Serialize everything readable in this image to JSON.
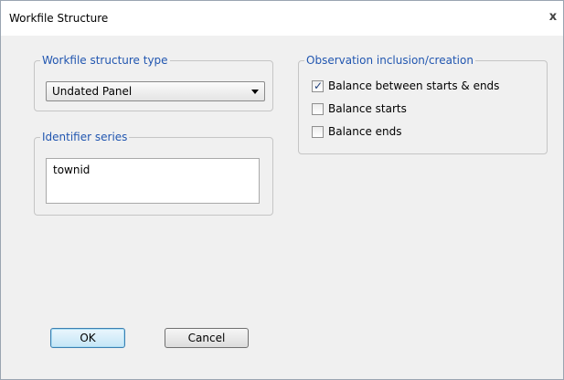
{
  "dialog": {
    "title": "Workfile Structure",
    "close_glyph": "x"
  },
  "structure_type": {
    "legend": "Workfile structure type",
    "selected": "Undated Panel"
  },
  "identifier_series": {
    "legend": "Identifier series",
    "items": [
      "townid"
    ]
  },
  "observation": {
    "legend": "Observation inclusion/creation",
    "options": [
      {
        "label": "Balance between starts & ends",
        "checked": true
      },
      {
        "label": "Balance starts",
        "checked": false
      },
      {
        "label": "Balance ends",
        "checked": false
      }
    ]
  },
  "buttons": {
    "ok_label": "OK",
    "cancel_label": "Cancel"
  },
  "icons": {
    "close": "close-icon",
    "dropdown": "chevron-down-icon",
    "check": "checkmark-icon"
  },
  "colors": {
    "legend_text": "#2156b0",
    "dialog_background": "#f0f0f0",
    "default_button_border": "#3c7fb1"
  }
}
